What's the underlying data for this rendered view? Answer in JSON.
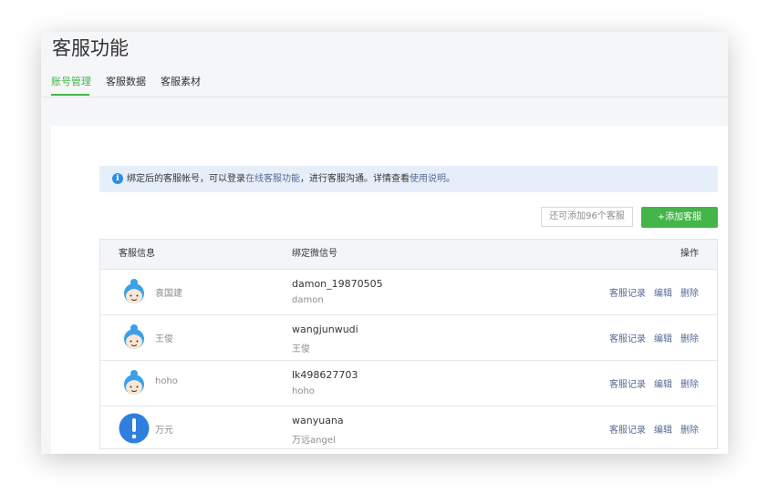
{
  "page": {
    "title": "客服功能"
  },
  "tabs": [
    {
      "label": "账号管理",
      "active": true
    },
    {
      "label": "客服数据",
      "active": false
    },
    {
      "label": "客服素材",
      "active": false
    }
  ],
  "notice": {
    "icon": "info-icon",
    "text_before": "绑定后的客服帐号，可以登录",
    "link1": "在线客服功能",
    "text_middle": "，进行客服沟通。详情查看",
    "link2": "使用说明",
    "text_after": "。"
  },
  "toolbar": {
    "quota_label": "还可添加96个客服",
    "add_label": "+添加客服"
  },
  "table": {
    "headers": {
      "info": "客服信息",
      "wechat": "绑定微信号",
      "ops": "操作"
    },
    "actions": {
      "records": "客服记录",
      "edit": "编辑",
      "delete": "删除"
    },
    "rows": [
      {
        "avatar": "service-avatar-icon",
        "name": "袁国建",
        "wechat_id": "damon_19870505",
        "nickname": "damon"
      },
      {
        "avatar": "service-avatar-icon",
        "name": "王俊",
        "wechat_id": "wangjunwudi",
        "nickname": "王俊"
      },
      {
        "avatar": "service-avatar-icon",
        "name": "hoho",
        "wechat_id": "lk498627703",
        "nickname": "hoho"
      },
      {
        "avatar": "exclamation-avatar-icon",
        "name": "万元",
        "wechat_id": "wanyuana",
        "nickname": "万远angel"
      }
    ]
  },
  "colors": {
    "accent": "#44b549",
    "link": "#576b95",
    "notice_bg": "#e6eff9",
    "info_icon": "#2d8fe3"
  }
}
